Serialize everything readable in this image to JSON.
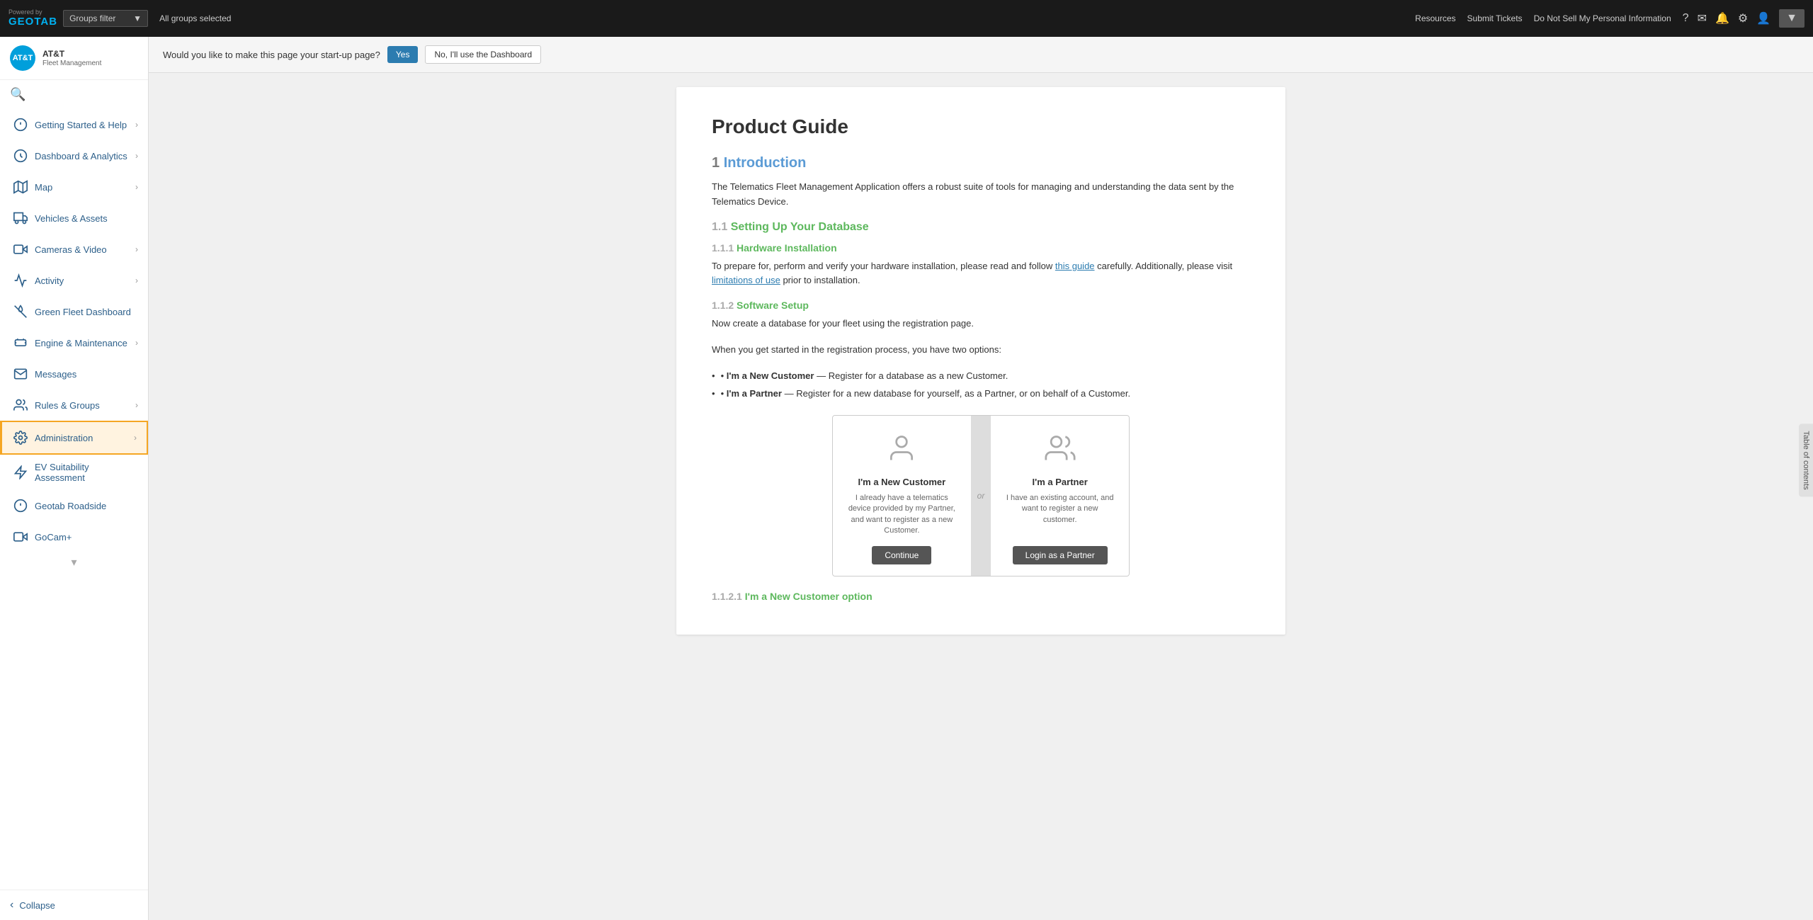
{
  "topbar": {
    "brand": "GEOTAB",
    "powered_by": "Powered by",
    "groups_filter_label": "Groups filter",
    "all_groups_label": "All groups selected",
    "links": [
      "Resources",
      "Submit Tickets",
      "Do Not Sell My Personal Information"
    ],
    "icons": [
      "help",
      "mail",
      "bell",
      "settings",
      "user"
    ]
  },
  "sidebar": {
    "logo_initials": "AT&T",
    "logo_name": "AT&T",
    "logo_sub": "Fleet Management",
    "search_placeholder": "Search",
    "items": [
      {
        "id": "getting-started",
        "label": "Getting Started & Help",
        "has_arrow": true,
        "active": false
      },
      {
        "id": "dashboard",
        "label": "Dashboard & Analytics",
        "has_arrow": true,
        "active": false
      },
      {
        "id": "map",
        "label": "Map",
        "has_arrow": true,
        "active": false
      },
      {
        "id": "vehicles",
        "label": "Vehicles & Assets",
        "has_arrow": false,
        "active": false
      },
      {
        "id": "cameras",
        "label": "Cameras & Video",
        "has_arrow": true,
        "active": false
      },
      {
        "id": "activity",
        "label": "Activity",
        "has_arrow": true,
        "active": false
      },
      {
        "id": "green-fleet",
        "label": "Green Fleet Dashboard",
        "has_arrow": false,
        "active": false
      },
      {
        "id": "engine",
        "label": "Engine & Maintenance",
        "has_arrow": true,
        "active": false
      },
      {
        "id": "messages",
        "label": "Messages",
        "has_arrow": false,
        "active": false
      },
      {
        "id": "rules",
        "label": "Rules & Groups",
        "has_arrow": true,
        "active": false
      },
      {
        "id": "administration",
        "label": "Administration",
        "has_arrow": true,
        "active": true
      },
      {
        "id": "ev-suitability",
        "label": "EV Suitability Assessment",
        "has_arrow": false,
        "active": false
      },
      {
        "id": "geotab-roadside",
        "label": "Geotab Roadside",
        "has_arrow": false,
        "active": false
      },
      {
        "id": "gocam",
        "label": "GoCam+",
        "has_arrow": false,
        "active": false
      }
    ],
    "collapse_label": "Collapse"
  },
  "startup_bar": {
    "question": "Would you like to make this page your start-up page?",
    "yes_label": "Yes",
    "no_label": "No, I'll use the Dashboard"
  },
  "toc": {
    "label": "Table of contents"
  },
  "doc": {
    "title": "Product Guide",
    "sections": [
      {
        "num": "1",
        "heading": "Introduction",
        "body": "The Telematics Fleet Management Application offers a robust suite of tools for managing and understanding the data sent by the Telematics Device."
      }
    ],
    "s11_num": "1.1",
    "s11_heading": "Setting Up Your Database",
    "s111_num": "1.1.1",
    "s111_heading": "Hardware Installation",
    "s111_body1": "To prepare for, perform and verify your hardware installation, please read and follow ",
    "s111_link1": "this guide",
    "s111_body2": " carefully. Additionally, please visit ",
    "s111_link2": "limitations of use",
    "s111_body3": " prior to installation.",
    "s112_num": "1.1.2",
    "s112_heading": "Software Setup",
    "s112_body1": "Now create a database for your fleet using the registration page.",
    "s112_body2": "When you get started in the registration process, you have two options:",
    "bullet1_bold": "I'm a New Customer",
    "bullet1_rest": " — Register for a database as a new Customer.",
    "bullet2_bold": "I'm a Partner",
    "bullet2_rest": " — Register for a new database for yourself, as a Partner, or on behalf of a Customer.",
    "card1_title": "I'm a New Customer",
    "card1_desc": "I already have a telematics device provided by my Partner, and want to register as a new Customer.",
    "card1_btn": "Continue",
    "card_or": "or",
    "card2_title": "I'm a Partner",
    "card2_desc": "I have an existing account, and want to register a new customer.",
    "card2_btn": "Login as a Partner",
    "s1121_num": "1.1.2.1",
    "s1121_heading": "I'm a New Customer option"
  }
}
